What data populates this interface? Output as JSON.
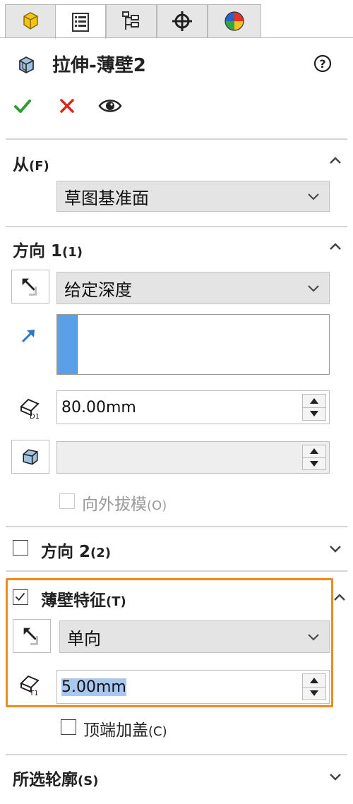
{
  "tabs": [
    {
      "name": "feature-manager-icon"
    },
    {
      "name": "property-manager-icon"
    },
    {
      "name": "configuration-manager-icon"
    },
    {
      "name": "dimxpert-icon"
    },
    {
      "name": "display-manager-icon"
    }
  ],
  "title": "拉伸-薄壁2",
  "from_section": {
    "header": "从",
    "shortcut": "(F)",
    "value": "草图基准面"
  },
  "direction1": {
    "header": "方向 1",
    "shortcut": "(1)",
    "end_condition": "给定深度",
    "depth_value": "80.00mm",
    "draft_value": "",
    "draft_outward_label": "向外拔模",
    "draft_outward_shortcut": "(O)"
  },
  "direction2": {
    "header": "方向 2",
    "shortcut": "(2)"
  },
  "thin_feature": {
    "header": "薄壁特征",
    "shortcut": "(T)",
    "type": "单向",
    "thickness_value": "5.00mm",
    "cap_ends_label": "顶端加盖",
    "cap_ends_shortcut": "(C)"
  },
  "selected_contours": {
    "header": "所选轮廓",
    "shortcut": "(S)"
  },
  "colors": {
    "highlight": "#f28a1f",
    "accept": "#2e9d2e",
    "cancel": "#d9261c",
    "selection": "#5aa0e8"
  }
}
